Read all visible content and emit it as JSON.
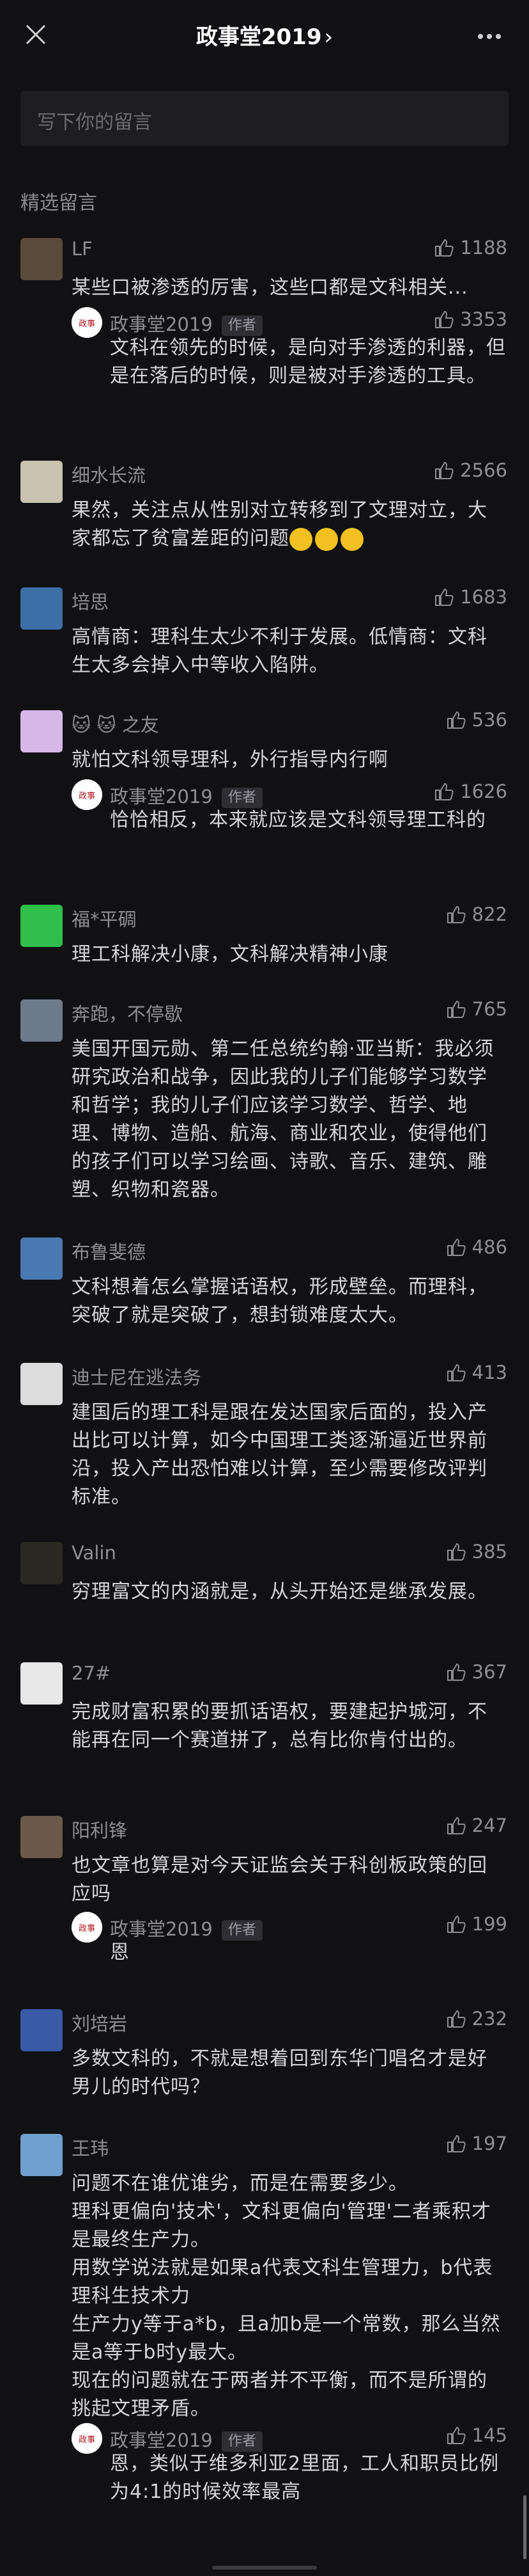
{
  "header": {
    "title": "政事堂2019",
    "chevron": "›",
    "close_icon": "close-icon",
    "more_icon": "more-icon"
  },
  "compose": {
    "placeholder": "写下你的留言"
  },
  "section_title": "精选留言",
  "author_tag": "作者",
  "reply_author": "政事堂2019",
  "comments": [
    {
      "name": "LF",
      "likes": "1188",
      "text": "某些口被渗透的厉害，这些口都是文科相关...",
      "reply": {
        "likes": "3353",
        "text": "文科在领先的时候，是向对手渗透的利器，但是在落后的时候，则是被对手渗透的工具。"
      }
    },
    {
      "name": "细水长流",
      "likes": "2566",
      "text": "果然，关注点从性别对立转移到了文理对立，大家都忘了贫富差距的问题"
    },
    {
      "name": "培思",
      "likes": "1683",
      "text": "高情商：理科生太少不利于发展。低情商：文科生太多会掉入中等收入陷阱。"
    },
    {
      "name": "🐱 🐱 之友",
      "likes": "536",
      "text": "就怕文科领导理科，外行指导内行啊",
      "reply": {
        "likes": "1626",
        "text": "恰恰相反，本来就应该是文科领导理工科的"
      }
    },
    {
      "name": "福*平碉",
      "likes": "822",
      "text": "理工科解决小康，文科解决精神小康"
    },
    {
      "name": "奔跑，不停歇",
      "likes": "765",
      "text": "美国开国元勋、第二任总统约翰·亚当斯：我必须研究政治和战争，因此我的儿子们能够学习数学和哲学；我的儿子们应该学习数学、哲学、地理、博物、造船、航海、商业和农业，使得他们的孩子们可以学习绘画、诗歌、音乐、建筑、雕塑、织物和瓷器。"
    },
    {
      "name": "布鲁斐德",
      "likes": "486",
      "text": "文科想着怎么掌握话语权，形成壁垒。而理科，突破了就是突破了，想封锁难度太大。"
    },
    {
      "name": "迪士尼在逃法务",
      "likes": "413",
      "text": "建国后的理工科是跟在发达国家后面的，投入产出比可以计算，如今中国理工类逐渐逼近世界前沿，投入产出恐怕难以计算，至少需要修改评判标准。"
    },
    {
      "name": "Valin",
      "likes": "385",
      "text": "穷理富文的内涵就是，从头开始还是继承发展。"
    },
    {
      "name": "27#",
      "likes": "367",
      "text": "完成财富积累的要抓话语权，要建起护城河，不能再在同一个赛道拼了，总有比你肯付出的。"
    },
    {
      "name": "阳利锋",
      "likes": "247",
      "text": "也文章也算是对今天证监会关于科创板政策的回应吗",
      "reply": {
        "likes": "199",
        "text": "恩"
      }
    },
    {
      "name": "刘培岩",
      "likes": "232",
      "text": "多数文科的，不就是想着回到东华门唱名才是好男儿的时代吗？"
    },
    {
      "name": "王玮",
      "likes": "197",
      "text": "问题不在谁优谁劣，而是在需要多少。\n理科更偏向'技术'，文科更偏向'管理'二者乘积才是最终生产力。\n用数学说法就是如果a代表文科生管理力，b代表理科生技术力\n生产力y等于a*b，且a加b是一个常数，那么当然是a等于b时y最大。\n现在的问题就在于两者并不平衡，而不是所谓的挑起文理矛盾。",
      "reply": {
        "likes": "145",
        "text": "恩，类似于维多利亚2里面，工人和职员比例为4:1的时候效率最高"
      }
    }
  ],
  "colors": {
    "background": "#111113",
    "text": "#d5d5d8",
    "muted": "#8e8e93"
  }
}
